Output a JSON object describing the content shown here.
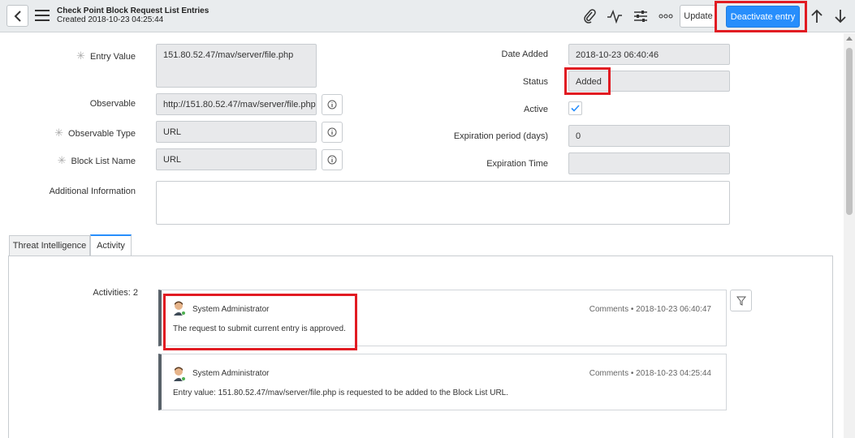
{
  "header": {
    "title": "Check Point Block Request List Entries",
    "subtitle": "Created 2018-10-23 04:25:44",
    "update_label": "Update",
    "deactivate_label": "Deactivate entry",
    "icons": [
      "back-icon",
      "menu-icon",
      "paperclip-icon",
      "activity-stream-icon",
      "settings-sliders-icon",
      "more-options-icon",
      "arrow-up-icon",
      "arrow-down-icon"
    ]
  },
  "form": {
    "entry_value": {
      "label": "Entry Value",
      "value": "151.80.52.47/mav/server/file.php"
    },
    "observable": {
      "label": "Observable",
      "value": "http://151.80.52.47/mav/server/file.php"
    },
    "observable_type": {
      "label": "Observable Type",
      "value": "URL"
    },
    "block_list_name": {
      "label": "Block List Name",
      "value": "URL"
    },
    "additional_information": {
      "label": "Additional Information",
      "value": ""
    },
    "date_added": {
      "label": "Date Added",
      "value": "2018-10-23 06:40:46"
    },
    "status": {
      "label": "Status",
      "value": "Added"
    },
    "active": {
      "label": "Active",
      "checked": true
    },
    "expiration_period": {
      "label": "Expiration period (days)",
      "value": "0"
    },
    "expiration_time": {
      "label": "Expiration Time",
      "value": ""
    }
  },
  "tabs": [
    {
      "label": "Threat Intelligence",
      "active": false
    },
    {
      "label": "Activity",
      "active": true
    }
  ],
  "activity": {
    "count_label": "Activities: 2",
    "entries": [
      {
        "user": "System Administrator",
        "type": "Comments",
        "timestamp": "2018-10-23 06:40:47",
        "text": "The request to submit current entry is approved."
      },
      {
        "user": "System Administrator",
        "type": "Comments",
        "timestamp": "2018-10-23 04:25:44",
        "text": "Entry value: 151.80.52.47/mav/server/file.php is requested to be added to the Block List URL."
      }
    ]
  },
  "colors": {
    "primary": "#278efc",
    "highlight": "#e11b22",
    "header_bg": "#e9ecee",
    "presence": "#4caf50"
  }
}
